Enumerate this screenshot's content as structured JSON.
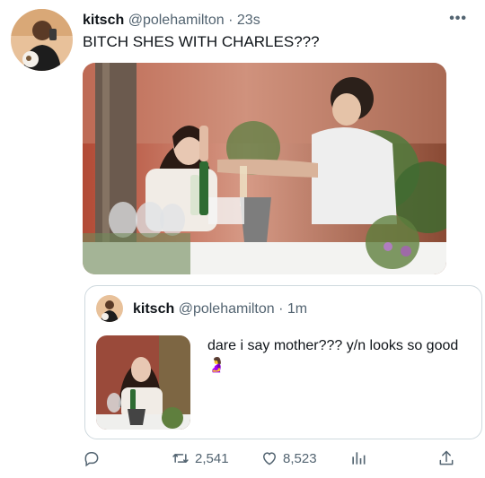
{
  "tweet": {
    "name": "kitsch",
    "handle": "@polehamilton",
    "separator": "·",
    "time": "23s",
    "text": "BITCH SHES WITH CHARLES???",
    "more_icon": "more-dots-icon"
  },
  "quoted": {
    "name": "kitsch",
    "handle": "@polehamilton",
    "separator": "·",
    "time": "1m",
    "text": "dare i say mother??? y/n looks so good",
    "emoji": "🤰"
  },
  "actions": {
    "reply_icon": "reply-icon",
    "retweet_count": "2,541",
    "like_count": "8,523",
    "analytics_icon": "analytics-icon",
    "share_icon": "share-icon"
  },
  "colors": {
    "text": "#0f1419",
    "muted": "#536471",
    "border": "#cfd9de"
  }
}
